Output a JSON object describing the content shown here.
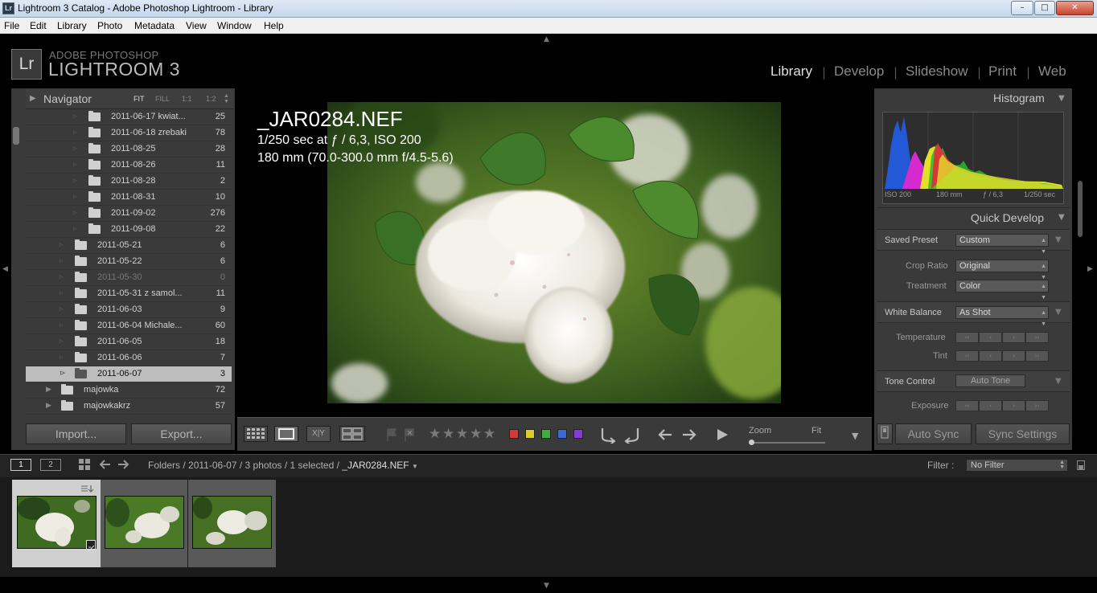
{
  "window": {
    "title": "Lightroom 3 Catalog - Adobe Photoshop Lightroom - Library",
    "icon_text": "Lr",
    "minimize_glyph": "–",
    "maximize_glyph": "□",
    "close_glyph": "✕"
  },
  "menu": [
    "File",
    "Edit",
    "Library",
    "Photo",
    "Metadata",
    "View",
    "Window",
    "Help"
  ],
  "brand": {
    "logo_text": "Lr",
    "small": "ADOBE PHOTOSHOP",
    "big": "LIGHTROOM 3"
  },
  "modules": [
    {
      "label": "Library",
      "active": true
    },
    {
      "label": "Develop",
      "active": false
    },
    {
      "label": "Slideshow",
      "active": false
    },
    {
      "label": "Print",
      "active": false
    },
    {
      "label": "Web",
      "active": false
    }
  ],
  "module_separator": "|",
  "navigator": {
    "label": "Navigator",
    "options": [
      "FIT",
      "FILL",
      "1:1",
      "1:2"
    ],
    "active_option": "FIT"
  },
  "folders": [
    {
      "name": "2011-06-17 kwiat...",
      "count": "25",
      "level": 2
    },
    {
      "name": "2011-06-18 zrebaki",
      "count": "78",
      "level": 2
    },
    {
      "name": "2011-08-25",
      "count": "28",
      "level": 2
    },
    {
      "name": "2011-08-26",
      "count": "11",
      "level": 2
    },
    {
      "name": "2011-08-28",
      "count": "2",
      "level": 2
    },
    {
      "name": "2011-08-31",
      "count": "10",
      "level": 2
    },
    {
      "name": "2011-09-02",
      "count": "276",
      "level": 2
    },
    {
      "name": "2011-09-08",
      "count": "22",
      "level": 2
    },
    {
      "name": "2011-05-21",
      "count": "6",
      "level": 1
    },
    {
      "name": "2011-05-22",
      "count": "6",
      "level": 1
    },
    {
      "name": "2011-05-30",
      "count": "0",
      "level": 1,
      "dim": true
    },
    {
      "name": "2011-05-31 z samol...",
      "count": "11",
      "level": 1
    },
    {
      "name": "2011-06-03",
      "count": "9",
      "level": 1
    },
    {
      "name": "2011-06-04 Michale...",
      "count": "60",
      "level": 1
    },
    {
      "name": "2011-06-05",
      "count": "18",
      "level": 1
    },
    {
      "name": "2011-06-06",
      "count": "7",
      "level": 1
    },
    {
      "name": "2011-06-07",
      "count": "3",
      "level": 1,
      "selected": true
    },
    {
      "name": "majowka",
      "count": "72",
      "level": 0,
      "expandable": true
    },
    {
      "name": "majowkakrz",
      "count": "57",
      "level": 0,
      "expandable": true
    }
  ],
  "left_buttons": {
    "import": "Import...",
    "export": "Export..."
  },
  "photo_info": {
    "filename": "_JAR0284.NEF",
    "exposure": "1/250 sec at ƒ / 6,3, ISO 200",
    "lens": "180 mm (70.0-300.0 mm f/4.5-5.6)"
  },
  "toolbar": {
    "view_xy": "X|Y",
    "stars": [
      "★",
      "★",
      "★",
      "★",
      "★"
    ],
    "color_labels": [
      "#d43a3a",
      "#d8cc2a",
      "#3fae3f",
      "#3a6ad4",
      "#8a3ad4"
    ],
    "zoom_label": "Zoom",
    "zoom_value": "Fit"
  },
  "histogram": {
    "label": "Histogram",
    "iso": "ISO 200",
    "focal": "180 mm",
    "aperture": "ƒ / 6,3",
    "shutter": "1/250 sec"
  },
  "quick_develop": {
    "label": "Quick Develop",
    "saved_preset_label": "Saved Preset",
    "saved_preset_value": "Custom",
    "crop_ratio_label": "Crop Ratio",
    "crop_ratio_value": "Original",
    "treatment_label": "Treatment",
    "treatment_value": "Color",
    "white_balance_label": "White Balance",
    "white_balance_value": "As Shot",
    "temperature_label": "Temperature",
    "tint_label": "Tint",
    "tone_control_label": "Tone Control",
    "auto_tone_label": "Auto Tone",
    "exposure_label": "Exposure",
    "step_buttons": [
      "‹‹",
      "‹",
      "›",
      "››"
    ]
  },
  "right_buttons": {
    "auto_sync": "Auto Sync",
    "sync_settings": "Sync Settings"
  },
  "filmbar": {
    "screen1": "1",
    "screen2": "2",
    "breadcrumb_prefix": "Folders / 2011-06-07 / 3 photos / 1 selected /",
    "breadcrumb_file": "_JAR0284.NEF",
    "filter_label": "Filter :",
    "filter_value": "No Filter"
  },
  "filmstrip_count": 3
}
